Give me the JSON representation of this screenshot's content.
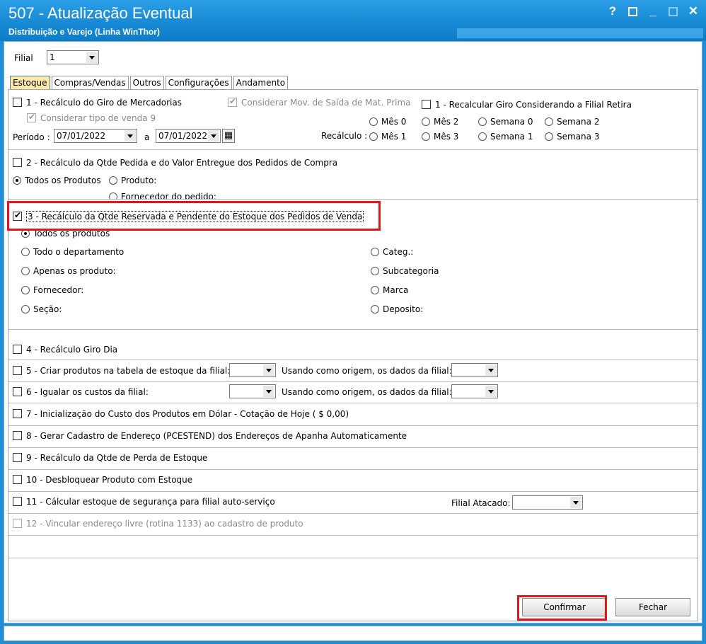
{
  "window": {
    "title": "507 - Atualização Eventual",
    "subtitle": "Distribuição e Varejo (Linha WinThor)",
    "controls": [
      "?",
      "_",
      "✕"
    ]
  },
  "filial": {
    "label": "Filial",
    "value": "1"
  },
  "tabs": [
    "Estoque",
    "Compras/Vendas",
    "Outros",
    "Configurações",
    "Andamento"
  ],
  "sec1": {
    "label": "1 - Recálculo do Giro de Mercadorias",
    "mov_saida": "Considerar Mov. de Saída de Mat. Prima",
    "filial_retira": "1 - Recalcular Giro Considerando a Filial Retira",
    "tipo_venda": "Considerar tipo de venda 9",
    "periodo_label": "Período :",
    "date_from": "07/01/2022",
    "a_label": "a",
    "date_to": "07/01/2022",
    "recalculo_label": "Recálculo :",
    "options": [
      "Mês 0",
      "Mês 2",
      "Semana 0",
      "Semana 2",
      "Mês 1",
      "Mês 3",
      "Semana 1",
      "Semana 3"
    ]
  },
  "sec2": {
    "label": "2 - Recálculo da Qtde Pedida e do Valor Entregue dos Pedidos de Compra",
    "todos": "Todos os Produtos",
    "produto": "Produto:",
    "fornecedor": "Fornecedor do pedido:"
  },
  "sec3": {
    "label": "3 - Recálculo da Qtde Reservada e Pendente do Estoque dos Pedidos de Venda",
    "todos": "Todos os produtos",
    "departamento": "Todo o departamento",
    "apenas": "Apenas os produto:",
    "fornecedor": "Fornecedor:",
    "secao": "Seção:",
    "categ": "Categ.:",
    "subcategoria": "Subcategoria",
    "marca": "Marca",
    "deposito": "Deposito:"
  },
  "items": {
    "i4": "4 - Recálculo Giro Dia",
    "i5": "5 - Criar produtos na tabela de estoque da filial:",
    "i6": "6 - Igualar os custos da filial:",
    "origem": "Usando como origem, os dados da filial:",
    "i7": "7 - Inicialização do Custo dos Produtos em Dólar - Cotação de Hoje ( $ 0,00)",
    "i8": "8 - Gerar Cadastro de Endereço (PCESTEND) dos Endereços de Apanha Automaticamente",
    "i9": "9 - Recálculo da Qtde de Perda de Estoque",
    "i10": "10 - Desbloquear Produto com Estoque",
    "i11": "11 - Cálcular estoque de segurança para filial auto-serviço",
    "filial_atacado": "Filial Atacado:",
    "i12": "12 - Vincular endereço livre (rotina 1133) ao cadastro de produto"
  },
  "buttons": {
    "confirmar": "Confirmar",
    "fechar": "Fechar"
  },
  "colors": {
    "titlebar": "#1789d4",
    "active_tab": "#ffe9a8",
    "highlight": "#e3141b"
  }
}
